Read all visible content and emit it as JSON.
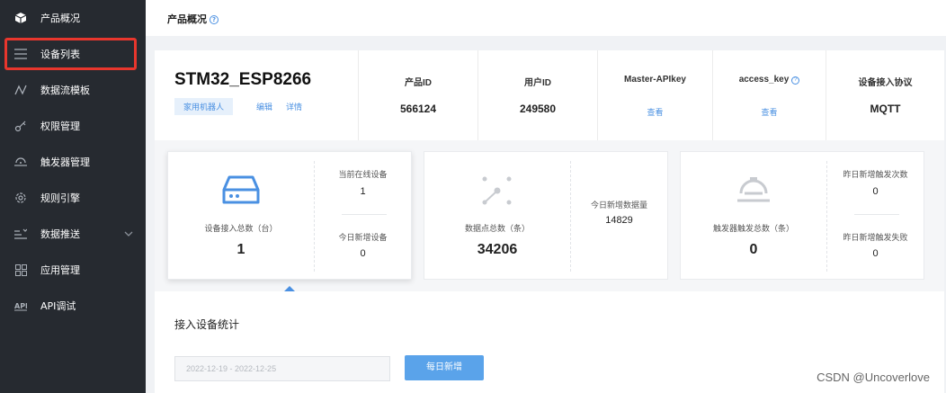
{
  "sidebar": {
    "items": [
      {
        "label": "产品概况",
        "icon": "cube-icon"
      },
      {
        "label": "设备列表",
        "icon": "list-icon"
      },
      {
        "label": "数据流模板",
        "icon": "flow-icon"
      },
      {
        "label": "权限管理",
        "icon": "key-icon"
      },
      {
        "label": "触发器管理",
        "icon": "trigger-icon"
      },
      {
        "label": "规则引擎",
        "icon": "gear-icon"
      },
      {
        "label": "数据推送",
        "icon": "push-icon"
      },
      {
        "label": "应用管理",
        "icon": "grid-icon"
      },
      {
        "label": "API调试",
        "icon": "api-icon"
      }
    ],
    "highlight_color": "#e8362d"
  },
  "header": {
    "title": "产品概况",
    "help": "?"
  },
  "product": {
    "name": "STM32_ESP8266",
    "tag": "家用机器人",
    "edit": "编辑",
    "detail": "详情",
    "fields": [
      {
        "key": "产品ID",
        "value": "566124"
      },
      {
        "key": "用户ID",
        "value": "249580"
      },
      {
        "key": "Master-APIkey",
        "value": "查看"
      },
      {
        "key": "access_key",
        "value": "查看"
      },
      {
        "key": "设备接入协议",
        "value": "MQTT"
      }
    ]
  },
  "stats": [
    {
      "label": "设备接入总数（台）",
      "value": "1",
      "r1_label": "当前在线设备",
      "r1_value": "1",
      "r2_label": "今日新增设备",
      "r2_value": "0"
    },
    {
      "label": "数据点总数（条）",
      "value": "34206",
      "r1_label": "今日新增数据量",
      "r1_value": "14829"
    },
    {
      "label": "触发器触发总数（条）",
      "value": "0",
      "r1_label": "昨日新增触发次数",
      "r1_value": "0",
      "r2_label": "昨日新增触发失败",
      "r2_value": "0"
    }
  ],
  "device_stats": {
    "title": "接入设备统计",
    "date_range": "2022-12-19 - 2022-12-25",
    "button": "每日新增"
  },
  "watermark": "CSDN @Uncoverlove",
  "colors": {
    "accent": "#4a90e2",
    "sidebar_bg": "#262a30"
  }
}
